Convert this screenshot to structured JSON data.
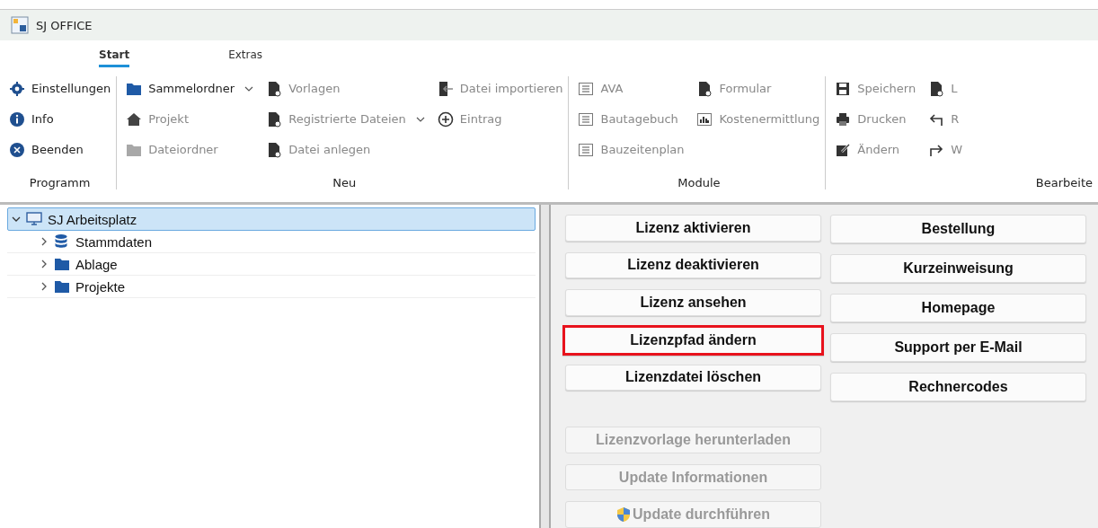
{
  "window": {
    "title": "SJ OFFICE"
  },
  "tabs": [
    {
      "label": "Start",
      "selected": true
    },
    {
      "label": "Extras",
      "selected": false
    }
  ],
  "ribbon": {
    "groups": [
      {
        "label": "Programm",
        "columns": [
          [
            {
              "label": "Einstellungen",
              "disabled": false
            },
            {
              "label": "Info",
              "disabled": false
            },
            {
              "label": "Beenden",
              "disabled": false
            }
          ]
        ]
      },
      {
        "label": "Neu",
        "columns": [
          [
            {
              "label": "Sammelordner",
              "disabled": false,
              "has_dropdown": true
            },
            {
              "label": "Projekt",
              "disabled": true
            },
            {
              "label": "Dateiordner",
              "disabled": true
            }
          ],
          [
            {
              "label": "Vorlagen",
              "disabled": true
            },
            {
              "label": "Registrierte Dateien",
              "disabled": true,
              "has_dropdown": true
            },
            {
              "label": "Datei anlegen",
              "disabled": true
            }
          ],
          [
            {
              "label": "Datei importieren",
              "disabled": true
            },
            {
              "label": "Eintrag",
              "disabled": true
            }
          ]
        ]
      },
      {
        "label": "Module",
        "columns": [
          [
            {
              "label": "AVA",
              "disabled": true
            },
            {
              "label": "Bautagebuch",
              "disabled": true
            },
            {
              "label": "Bauzeitenplan",
              "disabled": true
            }
          ],
          [
            {
              "label": "Formular",
              "disabled": true
            },
            {
              "label": "Kostenermittlung",
              "disabled": true
            }
          ]
        ]
      },
      {
        "label": "Bearbeite",
        "columns": [
          [
            {
              "label": "Speichern",
              "disabled": true
            },
            {
              "label": "Drucken",
              "disabled": true
            },
            {
              "label": "Ändern",
              "disabled": true
            }
          ],
          [
            {
              "label": "L",
              "disabled": true
            },
            {
              "label": "R",
              "disabled": true
            },
            {
              "label": "W",
              "disabled": true
            }
          ]
        ]
      }
    ]
  },
  "tree": [
    {
      "label": "SJ Arbeitsplatz",
      "expanded": true,
      "selected": true,
      "children": [
        {
          "label": "Stammdaten",
          "expanded": false,
          "selected": false
        },
        {
          "label": "Ablage",
          "expanded": false,
          "selected": false
        },
        {
          "label": "Projekte",
          "expanded": false,
          "selected": false
        }
      ]
    }
  ],
  "button_panel": {
    "columns": [
      [
        {
          "label": "Lizenz aktivieren",
          "disabled": false,
          "highlighted": false
        },
        {
          "label": "Lizenz deaktivieren",
          "disabled": false,
          "highlighted": false
        },
        {
          "label": "Lizenz ansehen",
          "disabled": false,
          "highlighted": false
        },
        {
          "label": "Lizenzpfad ändern",
          "disabled": false,
          "highlighted": true
        },
        {
          "label": "Lizenzdatei löschen",
          "disabled": false,
          "highlighted": false
        },
        {
          "label": "Lizenzvorlage herunterladen",
          "disabled": true,
          "highlighted": false,
          "gap_before": true
        },
        {
          "label": "Update Informationen",
          "disabled": true,
          "highlighted": false
        },
        {
          "label": "Update durchführen",
          "disabled": true,
          "highlighted": false,
          "shield": true
        }
      ],
      [
        {
          "label": "Bestellung",
          "disabled": false,
          "highlighted": false
        },
        {
          "label": "Kurzeinweisung",
          "disabled": false,
          "highlighted": false
        },
        {
          "label": "Homepage",
          "disabled": false,
          "highlighted": false
        },
        {
          "label": "Support per E-Mail",
          "disabled": false,
          "highlighted": false
        },
        {
          "label": "Rechnercodes",
          "disabled": false,
          "highlighted": false
        }
      ]
    ]
  }
}
